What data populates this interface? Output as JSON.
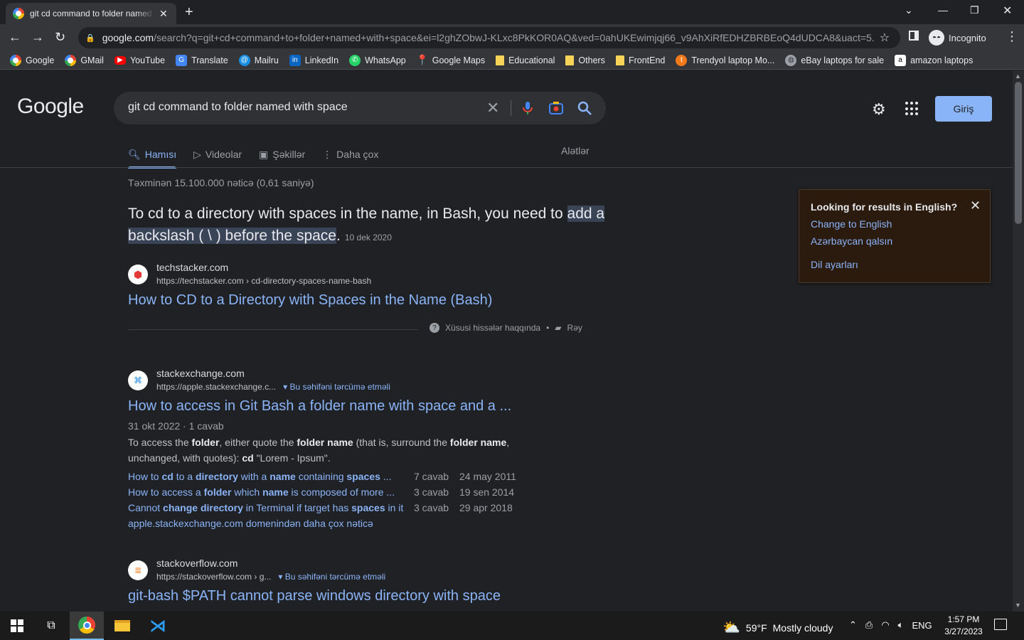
{
  "browser": {
    "tab_title": "git cd command to folder named with space - Google Search",
    "url_host": "google.com",
    "url_path": "/search?q=git+cd+command+to+folder+named+with+space&ei=l2ghZObwJ-KLxc8PkKOR0AQ&ved=0ahUKEwimjqj66_v9AhXiRfEDHZBRBEoQ4dUDCA8&uact=5...",
    "profile_label": "Incognito"
  },
  "bookmarks": [
    {
      "label": "Google"
    },
    {
      "label": "GMail"
    },
    {
      "label": "YouTube"
    },
    {
      "label": "Translate"
    },
    {
      "label": "Mailru"
    },
    {
      "label": "LinkedIn"
    },
    {
      "label": "WhatsApp"
    },
    {
      "label": "Google Maps"
    },
    {
      "label": "Educational"
    },
    {
      "label": "Others"
    },
    {
      "label": "FrontEnd"
    },
    {
      "label": "Trendyol laptop Mo..."
    },
    {
      "label": "eBay laptops for sale"
    },
    {
      "label": "amazon laptops"
    }
  ],
  "google": {
    "logo": "Google",
    "query": "git cd command to folder named with space",
    "signin_label": "Giriş",
    "tabs": [
      "Hamısı",
      "Videolar",
      "Şəkillər",
      "Daha çox"
    ],
    "tools_label": "Alətlər",
    "stats": "Təxminən 15.100.000 nəticə (0,61 saniyə)"
  },
  "featured": {
    "text_1": "To cd to a directory with spaces in the name, in Bash, you need to ",
    "highlight": "add a backslash ( \\ ) before the space",
    "text_2": ".",
    "date": "10 dek 2020",
    "site": "techstacker.com",
    "crumb": "https://techstacker.com › cd-directory-spaces-name-bash",
    "title": "How to CD to a Directory with Spaces in the Name (Bash)",
    "about": "Xüsusi hissələr haqqında",
    "feedback": "Rəy"
  },
  "results": [
    {
      "site": "stackexchange.com",
      "crumb": "https://apple.stackexchange.c...",
      "translate": "Bu səhifəni tərcümə etməli",
      "title": "How to access in Git Bash a folder name with space and a ...",
      "meta": "31 okt 2022 · 1 cavab",
      "desc_parts": [
        "To access the ",
        "folder",
        ", either quote the ",
        "folder name",
        " (that is, surround the ",
        "folder name",
        ", unchanged, with quotes): ",
        "cd",
        " \"Lorem - Ipsum\"."
      ],
      "subs": [
        {
          "parts": [
            "How to ",
            "cd",
            " to a ",
            "directory",
            " with a ",
            "name",
            " containing ",
            "spaces",
            " ..."
          ],
          "answers": "7 cavab",
          "date": "24 may 2011"
        },
        {
          "parts": [
            "How to access a ",
            "folder",
            " which ",
            "name",
            " is composed of more ..."
          ],
          "answers": "3 cavab",
          "date": "19 sen 2014"
        },
        {
          "parts": [
            "Cannot ",
            "change directory",
            " in Terminal if target has ",
            "spaces",
            " in it"
          ],
          "answers": "3 cavab",
          "date": "29 apr 2018"
        }
      ],
      "more": "apple.stackexchange.com domenindən daha çox nəticə"
    },
    {
      "site": "stackoverflow.com",
      "crumb": "https://stackoverflow.com › g...",
      "translate": "Bu səhifəni tərcümə etməli",
      "title": "git-bash $PATH cannot parse windows directory with space"
    }
  ],
  "lang_box": {
    "heading": "Looking for results in English?",
    "option_1": "Change to English",
    "option_2": "Azərbaycan qalsın",
    "settings": "Dil ayarları"
  },
  "taskbar": {
    "weather_temp": "59°F",
    "weather_desc": "Mostly cloudy",
    "lang": "ENG",
    "time": "1:57 PM",
    "date": "3/27/2023"
  },
  "colors": {
    "link": "#8ab4f8",
    "page_bg": "#202124",
    "highlight": "#394457"
  }
}
